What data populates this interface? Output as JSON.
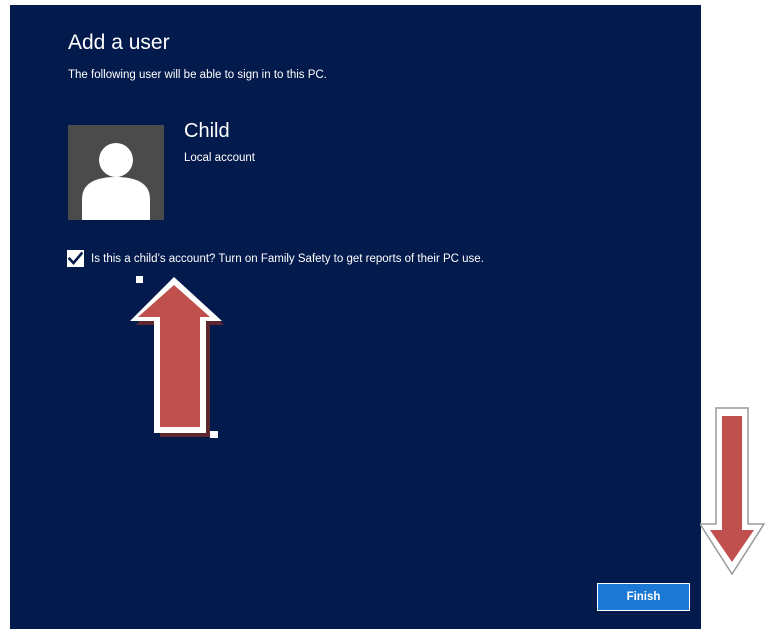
{
  "dialog": {
    "title": "Add a user",
    "subtitle": "The following user will be able to sign in to this PC."
  },
  "user": {
    "name": "Child",
    "account_type": "Local account",
    "avatar_icon": "user-silhouette-icon"
  },
  "family_safety": {
    "checked": true,
    "label": "Is this a child’s account? Turn on Family Safety to get reports of their PC use."
  },
  "footer": {
    "finish_label": "Finish"
  },
  "annotations": {
    "up_arrow_icon": "arrow-up-icon",
    "down_arrow_icon": "arrow-down-icon",
    "arrow_color": "#c0504d"
  },
  "colors": {
    "background": "#031a4c",
    "button": "#1b78d4"
  }
}
